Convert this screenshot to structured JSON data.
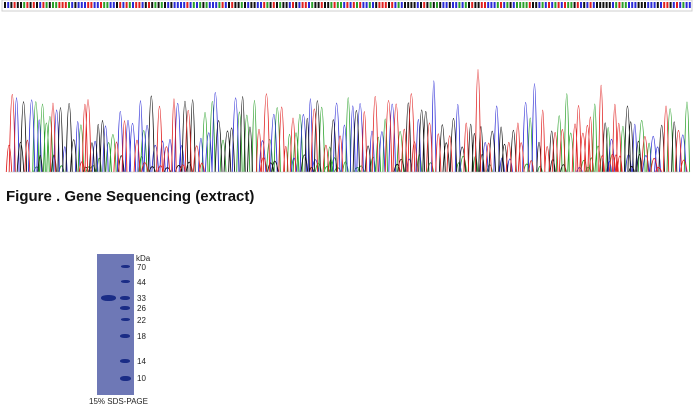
{
  "sequencing": {
    "caption": "Figure . Gene Sequencing (extract)",
    "trace_colors": {
      "A": "#2aa12a",
      "C": "#2b2bd6",
      "G": "#111111",
      "T": "#e02020"
    }
  },
  "gel": {
    "unit_label": "kDa",
    "markers": [
      "70",
      "44",
      "33",
      "26",
      "22",
      "18",
      "14",
      "10"
    ],
    "caption": "15% SDS-PAGE",
    "lane_color": "#6e78b6",
    "band_color": "#1a2c86"
  }
}
